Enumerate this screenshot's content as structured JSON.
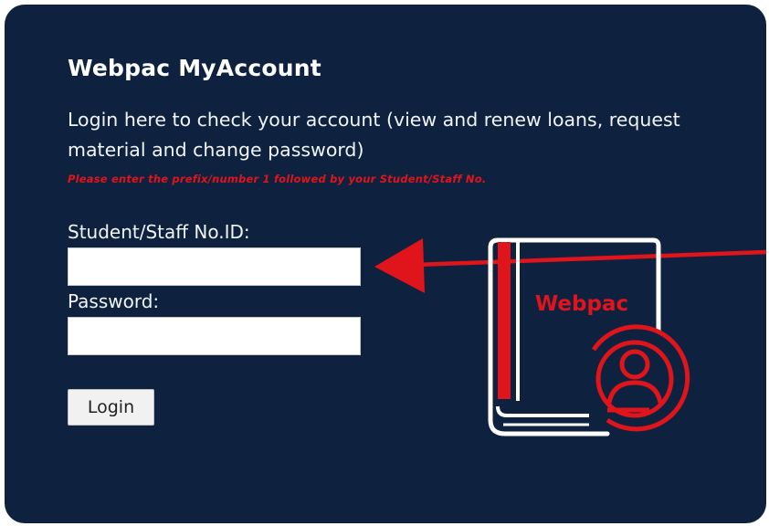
{
  "login": {
    "title": "Webpac MyAccount",
    "subtitle": "Login here to check your account (view and renew loans, request material and change password)",
    "notice": "Please enter the prefix/number 1 followed by your Student/Staff No.",
    "student_label": "Student/Staff No.ID:",
    "student_value": "",
    "password_label": "Password:",
    "password_value": "",
    "button_label": "Login"
  },
  "illustration": {
    "book_label": "Webpac"
  },
  "colors": {
    "background": "#0e2240",
    "accent": "#e0141b",
    "text": "#ffffff"
  },
  "icons": [
    "arrow-pointer-icon",
    "book-icon",
    "user-account-icon"
  ]
}
